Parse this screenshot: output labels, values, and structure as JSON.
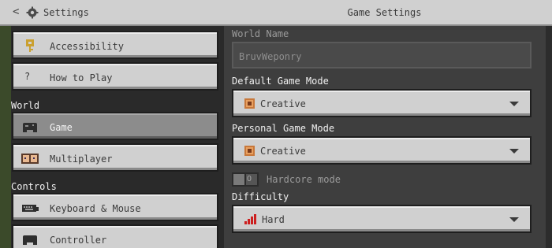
{
  "header": {
    "back_glyph": "<",
    "breadcrumb": "Settings",
    "title": "Game Settings"
  },
  "sidebar": {
    "items_top": [
      {
        "label": "Accessibility",
        "icon": "key-icon"
      },
      {
        "label": "How to Play",
        "icon": "question-icon",
        "glyph": "?"
      }
    ],
    "section_world": "World",
    "items_world": [
      {
        "label": "Game",
        "icon": "controller-icon",
        "selected": true
      },
      {
        "label": "Multiplayer",
        "icon": "players-icon"
      }
    ],
    "section_controls": "Controls",
    "items_controls": [
      {
        "label": "Keyboard & Mouse",
        "icon": "keyboard-icon"
      },
      {
        "label": "Controller",
        "icon": "controller-icon"
      }
    ]
  },
  "main": {
    "world_name_label": "World Name",
    "world_name_value": "BruvWeponry",
    "default_mode_label": "Default Game Mode",
    "default_mode_value": "Creative",
    "personal_mode_label": "Personal Game Mode",
    "personal_mode_value": "Creative",
    "hardcore_label": "Hardcore mode",
    "hardcore_toggle_glyph": "O",
    "hardcore_on": false,
    "difficulty_label": "Difficulty",
    "difficulty_value": "Hard"
  },
  "colors": {
    "panel": "#d0d0d0",
    "selected": "#8c8c8c",
    "background": "#3e3e3e",
    "creative_icon": "#c8783a",
    "hard_icon": "#cc1f1f"
  }
}
